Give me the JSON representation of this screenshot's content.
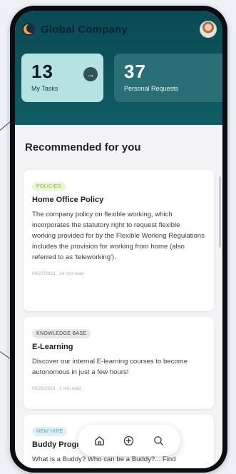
{
  "header": {
    "company_name": "Global Company",
    "logo_icon": "company-logo-icon",
    "avatar_icon": "user-avatar-icon"
  },
  "stats": [
    {
      "value": "13",
      "label": "My Tasks",
      "action_icon": "arrow-right-icon"
    },
    {
      "value": "37",
      "label": "Personal Requests",
      "action_icon": "arrow-right-icon"
    }
  ],
  "recommended": {
    "title": "Recommended for you",
    "items": [
      {
        "tag": "POLICIES",
        "title": "Home Office Policy",
        "body": "The company policy on flexible working, which incorporates the statutory right to request flexible working provided for by the Flexible Working Regulations includes the provision for working from home (also referred to as 'teleworking').",
        "meta": "04/27/2023 . 14 min read"
      },
      {
        "tag": "KNOWLEDGE BASE",
        "title": "E-Learning",
        "body": "Discover our internal E-learning courses to become autonomous in just a few hours!",
        "meta": "05/25/2023 . 1 min read"
      },
      {
        "tag": "NEW HIRE",
        "title": "Buddy Program",
        "body": "What is a Buddy? Who can be a Buddy?... Find",
        "meta": ""
      }
    ]
  },
  "bottom_nav": [
    {
      "name": "home",
      "icon": "home-icon"
    },
    {
      "name": "add",
      "icon": "plus-circle-icon"
    },
    {
      "name": "search",
      "icon": "search-icon"
    }
  ],
  "colors": {
    "header_bg": "#0f5d66",
    "tasks_card": "#b6e3e2",
    "requests_card": "#2b6f76",
    "policies_tag": "#8bb14b",
    "newhire_tag": "#4aa6bf"
  }
}
